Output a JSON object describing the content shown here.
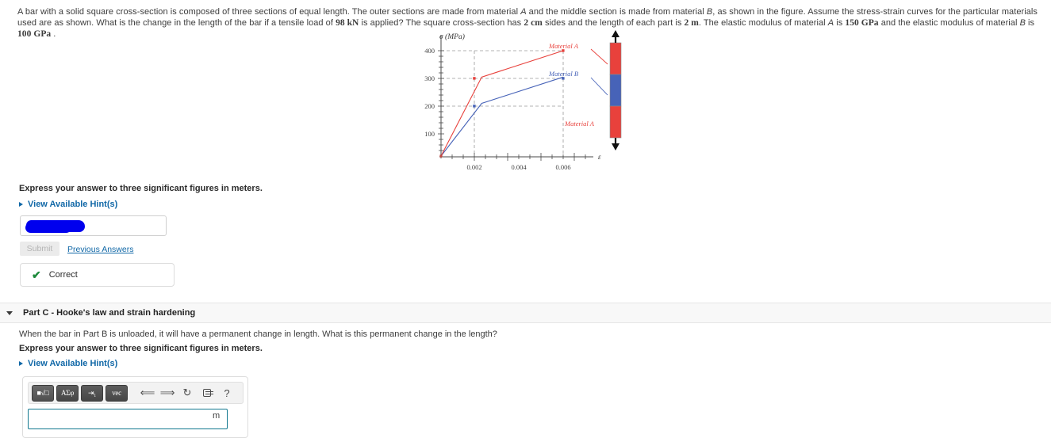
{
  "problem": {
    "paragraph_1": "A bar with a solid square cross-section is composed of three sections of equal length. The outer sections are made from material ",
    "mat_a_1": "A",
    "paragraph_2": " and the middle section is made from material ",
    "mat_b_1": "B",
    "paragraph_3": ", as shown in the figure. Assume the stress-strain curves for the particular materials used are as shown. What is the change in the length of the bar if a tensile load of ",
    "load": "98 kN",
    "paragraph_4": " is applied? The square cross-section has ",
    "side": "2 cm",
    "paragraph_5": " sides and the length of each part is ",
    "length": "2 m",
    "paragraph_6": ". The elastic modulus of material ",
    "mat_a_2": "A",
    "paragraph_7": " is ",
    "modulus_a": "150 GPa",
    "paragraph_8": " and the elastic modulus of material ",
    "mat_b_2": "B",
    "paragraph_9": " is ",
    "modulus_b": "100 GPa",
    "paragraph_10": " ."
  },
  "chart_data": {
    "type": "line",
    "title": "",
    "xlabel": "ε",
    "ylabel": "σ  (MPa)",
    "xlim": [
      0,
      0.0072
    ],
    "ylim": [
      0,
      440
    ],
    "xticks": [
      0.002,
      0.004,
      0.006
    ],
    "xticklabels": [
      "0.002",
      "0.004",
      "0.006"
    ],
    "yticks": [
      100,
      200,
      300,
      400
    ],
    "yticklabels": [
      "100",
      "200",
      "300",
      "400"
    ],
    "grid": "dashed-guides",
    "legend_position": "right-inline",
    "series": [
      {
        "name": "Material A",
        "color": "#e8413c",
        "x": [
          0,
          0.002,
          0.006
        ],
        "y": [
          0,
          300,
          400
        ]
      },
      {
        "name": "Material B",
        "color": "#4763b8",
        "x": [
          0,
          0.002,
          0.006
        ],
        "y": [
          0,
          200,
          300
        ]
      }
    ],
    "annotations": [
      {
        "text": "Material A",
        "color": "#e8413c",
        "target": "top-curve"
      },
      {
        "text": "Material B",
        "color": "#4763b8",
        "target": "lower-curve"
      },
      {
        "text": "Material A",
        "color": "#e8413c",
        "target": "bar-bottom-section"
      }
    ],
    "bar_diagram": {
      "sections": [
        {
          "material": "A",
          "color": "#e8413c"
        },
        {
          "material": "B",
          "color": "#4763b8"
        },
        {
          "material": "A",
          "color": "#e8413c"
        }
      ],
      "load_arrows": "tensile-both-ends"
    }
  },
  "part_b": {
    "express_instruction": "Express your answer to three significant figures in meters.",
    "hint_label": "View Available Hint(s)",
    "answer_value": "",
    "submit_label": "Submit",
    "previous_answers_label": "Previous Answers",
    "feedback_label": "Correct",
    "feedback_icon": "check-icon"
  },
  "part_c": {
    "header_title": "Part C - Hooke's law and strain hardening",
    "question": "When the bar in Part B is unloaded, it will have a permanent change in length. What is this permanent change in the length?",
    "express_instruction": "Express your answer to three significant figures in meters.",
    "hint_label": "View Available Hint(s)",
    "answer_value": "",
    "unit": "m",
    "toolbar": {
      "template_button": "■√□",
      "greek_button": "ΑΣφ",
      "subsup_button": "⇥₁",
      "vec_button": "vec",
      "undo_icon": "undo-arrow-icon",
      "redo_icon": "redo-arrow-icon",
      "reset_icon": "reset-circular-arrow-icon",
      "keyboard_icon": "keyboard-icon",
      "help_label": "?"
    }
  },
  "colors": {
    "material_a": "#e8413c",
    "material_b": "#4763b8",
    "link": "#1168a7",
    "correct_green": "#1e8a3c",
    "input_focus_border": "#11788f"
  }
}
